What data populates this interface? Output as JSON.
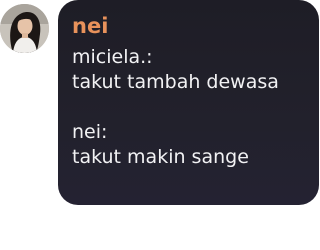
{
  "message": {
    "sender": "nei",
    "lines": [
      "miciela.:",
      "takut tambah dewasa",
      "",
      "nei:",
      "takut makin sange"
    ]
  },
  "colors": {
    "bubble_bg": "#1f1e28",
    "sender_name": "#e8925b",
    "text": "#f2f2f4"
  },
  "icons": {
    "avatar": "user-avatar-photo"
  }
}
